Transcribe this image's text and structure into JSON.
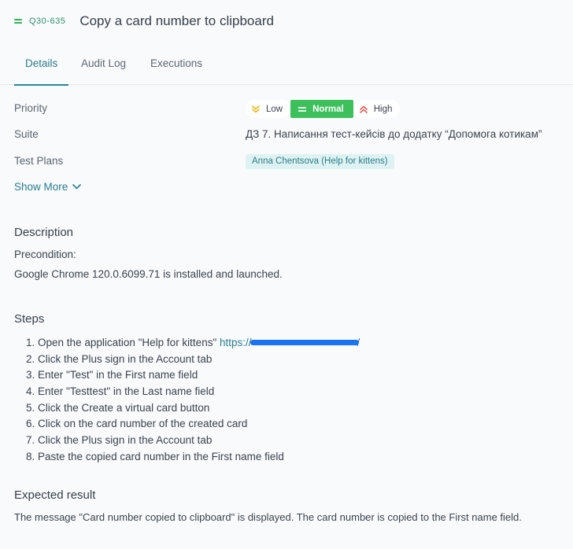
{
  "header": {
    "priority_icon": "equals-icon",
    "case_id": "Q30-635",
    "title": "Copy a card number to clipboard"
  },
  "tabs": [
    {
      "label": "Details",
      "active": true
    },
    {
      "label": "Audit Log",
      "active": false
    },
    {
      "label": "Executions",
      "active": false
    }
  ],
  "properties": {
    "priority_label": "Priority",
    "priority_options": [
      {
        "label": "Low",
        "icon": "chevron-double-down-icon",
        "color": "#f2b713",
        "selected": false
      },
      {
        "label": "Normal",
        "icon": "equals-icon",
        "color": "#3dc05c",
        "selected": true
      },
      {
        "label": "High",
        "icon": "chevron-double-up-icon",
        "color": "#e8584f",
        "selected": false
      }
    ],
    "suite_label": "Suite",
    "suite_value": "ДЗ 7. Написання тест-кейсів до додатку “Допомога котикам”",
    "test_plans_label": "Test Plans",
    "test_plan_tag": "Anna Chentsova (Help for kittens)",
    "show_more": "Show More"
  },
  "description": {
    "title": "Description",
    "precondition_label": "Precondition:",
    "precondition_text": "Google Chrome 120.0.6099.71 is installed and launched."
  },
  "steps": {
    "title": "Steps",
    "items": [
      {
        "num": "1.",
        "text": "Open the application \"Help for kittens\" ",
        "link_prefix": "https://",
        "link_suffix": "/"
      },
      {
        "num": "2.",
        "text": "Click the Plus sign in the Account tab"
      },
      {
        "num": "3.",
        "text": "Enter \"Test\" in the First name field"
      },
      {
        "num": "4.",
        "text": "Enter \"Testtest\" in the Last name field"
      },
      {
        "num": "5.",
        "text": "Click the Create a virtual card button"
      },
      {
        "num": "6.",
        "text": "Click on the card number of the created card"
      },
      {
        "num": "7.",
        "text": "Click the Plus sign in the Account tab"
      },
      {
        "num": "8.",
        "text": "Paste the copied card number in the First name field"
      }
    ]
  },
  "expected": {
    "title": "Expected result",
    "text": "The message \"Card number copied to clipboard\" is displayed. The card number is copied to the First name field."
  }
}
